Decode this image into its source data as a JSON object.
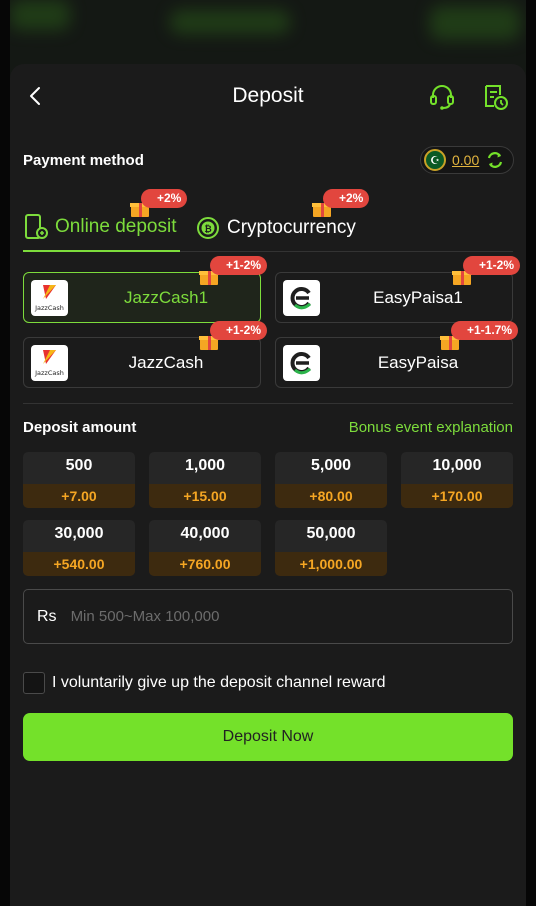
{
  "header": {
    "title": "Deposit",
    "back_icon": "chevron-left-icon",
    "support_icon": "headset-icon",
    "history_icon": "document-clock-icon"
  },
  "payment_method": {
    "label": "Payment method",
    "balance": "0.00",
    "currency_flag_icon": "pakistan-flag-icon",
    "refresh_icon": "refresh-icon"
  },
  "tabs": [
    {
      "label": "Online deposit",
      "badge": "+2%",
      "icon": "phone-deposit-icon",
      "active": true
    },
    {
      "label": "Cryptocurrency",
      "badge": "+2%",
      "icon": "bitcoin-icon",
      "active": false
    }
  ],
  "methods": [
    {
      "name": "JazzCash1",
      "badge": "+1-2%",
      "logo": "jazzcash-logo",
      "logo_text": "JazzCash",
      "active": true
    },
    {
      "name": "EasyPaisa1",
      "badge": "+1-2%",
      "logo": "easypaisa-logo",
      "active": false
    },
    {
      "name": "JazzCash",
      "badge": "+1-2%",
      "logo": "jazzcash-logo",
      "logo_text": "JazzCash",
      "active": false
    },
    {
      "name": "EasyPaisa",
      "badge": "+1-1.7%",
      "logo": "easypaisa-logo",
      "active": false
    }
  ],
  "deposit_amount": {
    "label": "Deposit amount",
    "bonus_link": "Bonus event explanation",
    "options": [
      {
        "value": "500",
        "bonus": "+7.00"
      },
      {
        "value": "1,000",
        "bonus": "+15.00"
      },
      {
        "value": "5,000",
        "bonus": "+80.00"
      },
      {
        "value": "10,000",
        "bonus": "+170.00"
      },
      {
        "value": "30,000",
        "bonus": "+540.00"
      },
      {
        "value": "40,000",
        "bonus": "+760.00"
      },
      {
        "value": "50,000",
        "bonus": "+1,000.00"
      }
    ]
  },
  "amount_input": {
    "currency": "Rs",
    "value": "",
    "placeholder": "Min 500~Max 100,000"
  },
  "waiver_checkbox": {
    "label": "I voluntarily give up the deposit channel reward",
    "checked": false
  },
  "submit": {
    "label": "Deposit Now"
  },
  "colors": {
    "accent": "#74e12a",
    "badge": "#e2463e",
    "bonus": "#f5a623",
    "panel": "#1b1b1b"
  }
}
